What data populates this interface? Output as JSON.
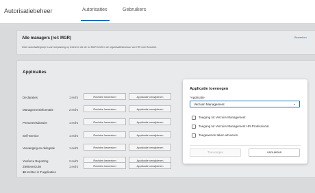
{
  "header": {
    "app_title": "Autorisatiebeheer",
    "tabs": [
      {
        "label": "Autorisaties"
      },
      {
        "label": "Gebruikers"
      }
    ]
  },
  "managers": {
    "title": "Alle managers (rol: MGR)",
    "description": "Deze autorisatiegroep is van toepassing op iedereen die de rol MGR heeft in de organisatiestructuur van HR Core Beaufort.",
    "edit_label": "Bewerken"
  },
  "applications": {
    "title": "Applicaties",
    "edit_button": "Rechten bewerken",
    "remove_button": "Applicatie verwijderen",
    "rows": [
      {
        "name": "Declaraties",
        "count": "1 recht"
      },
      {
        "name": "Managementinformatie",
        "count": "2 recht"
      },
      {
        "name": "Personeelsdossier",
        "count": "1 recht"
      },
      {
        "name": "Self-Service",
        "count": "1 recht"
      },
      {
        "name": "Vervanging en delegatie",
        "count": "1 recht"
      },
      {
        "name": "Youforce Reporting",
        "count": "2 recht"
      },
      {
        "name": "Ziekteverzuim",
        "count": "1 recht"
      }
    ],
    "footer_count": "10",
    "footer_text_1": " rechten in ",
    "footer_apps": "7",
    "footer_text_2": " applicaties"
  },
  "dialog": {
    "title": "Applicatie toevoegen",
    "label": "*Applicatie",
    "selected": "Verzuim Management",
    "options": [
      {
        "label": "Toegang tot Verzuim Management"
      },
      {
        "label": "Toegang tot Verzuim Management HR-Professional"
      },
      {
        "label": "Toegewezen taken uitvoeren"
      }
    ],
    "add_button": "Toevoegen",
    "cancel_button": "Annuleren"
  }
}
